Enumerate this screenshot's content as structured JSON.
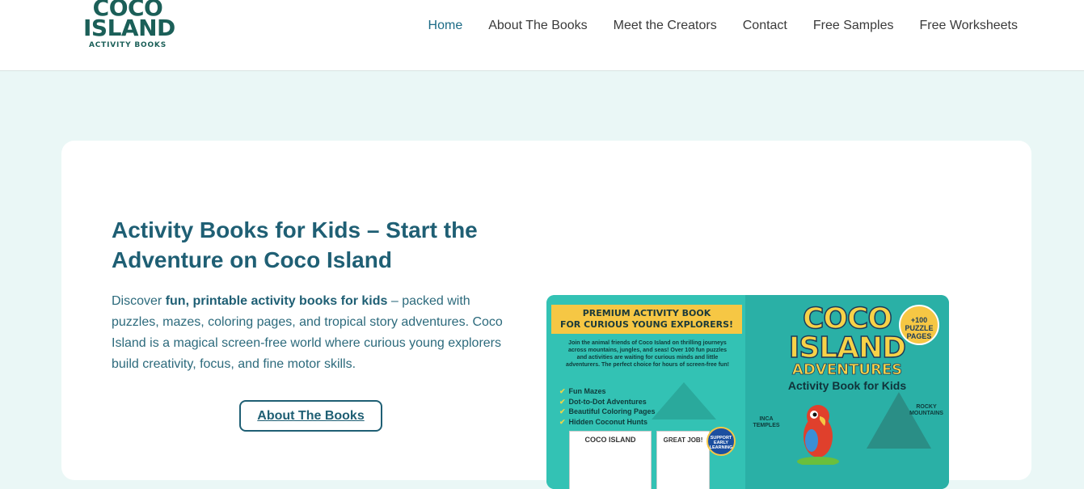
{
  "logo": {
    "line1": "COCO",
    "line2": "ISLAND",
    "line3": "ACTIVITY BOOKS"
  },
  "nav": [
    {
      "label": "Home",
      "active": true
    },
    {
      "label": "About The Books"
    },
    {
      "label": "Meet the Creators"
    },
    {
      "label": "Contact"
    },
    {
      "label": "Free Samples"
    },
    {
      "label": "Free Worksheets"
    }
  ],
  "hero": {
    "title": "Activity Books for Kids – Start the Adventure on Coco Island",
    "desc_before": "Discover ",
    "desc_bold": "fun, printable activity books for kids",
    "desc_after": " – packed with puzzles, mazes, coloring pages, and tropical story adventures. Coco Island is a magical screen-free world where curious young explorers build creativity, focus, and fine motor skills.",
    "button": "About The Books"
  },
  "book": {
    "back_banner_1": "PREMIUM ACTIVITY BOOK",
    "back_banner_2": "FOR CURIOUS YOUNG EXPLORERS!",
    "blurb": "Join the animal friends of Coco Island on thrilling journeys across mountains, jungles, and seas! Over 100 fun puzzles and activities are waiting for curious minds and little adventurers. The perfect choice for hours of screen-free fun!",
    "features": [
      "Fun Mazes",
      "Dot-to-Dot Adventures",
      "Beautiful Coloring Pages",
      "Hidden Coconut Hunts"
    ],
    "mini1": "COCO ISLAND",
    "mini2": "GREAT JOB!",
    "support_badge": "SUPPORT EARLY LEARNING",
    "front_title_1": "COCO",
    "front_title_2": "ISLAND",
    "front_sub": "ADVENTURES",
    "front_sub2": "Activity Book for Kids",
    "badge": "+100 PUZZLE PAGES",
    "label_left": "INCA TEMPLES",
    "label_right": "ROCKY MOUNTAINS"
  }
}
